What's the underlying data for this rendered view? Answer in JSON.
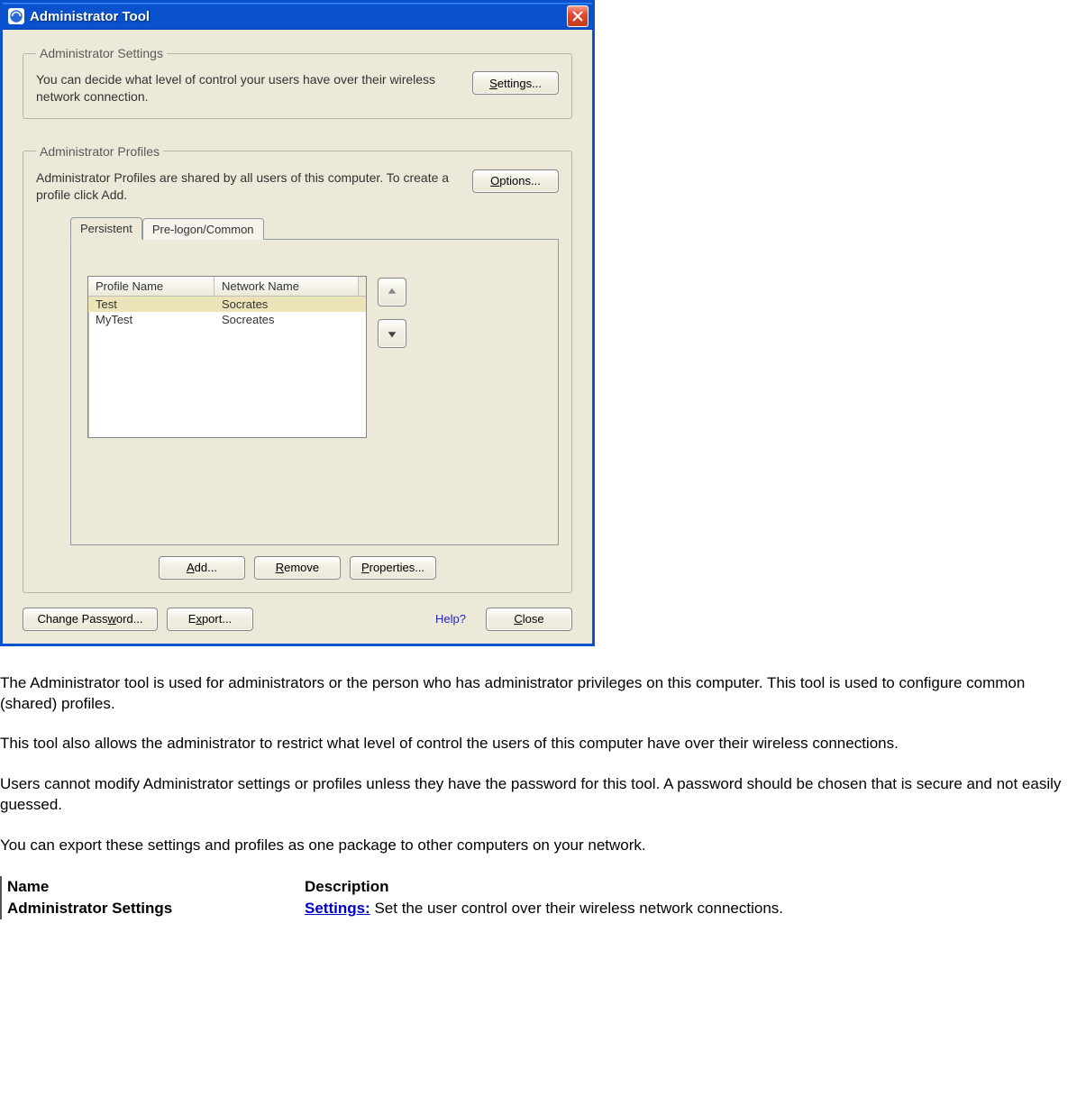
{
  "window": {
    "title": "Administrator Tool"
  },
  "admin_settings": {
    "legend": "Administrator Settings",
    "text": "You can decide what level of control your users have over their wireless network connection.",
    "button": "Settings..."
  },
  "admin_profiles": {
    "legend": "Administrator Profiles",
    "text": "Administrator Profiles are shared by all users of this computer. To create a profile click Add.",
    "button": "Options...",
    "tabs": {
      "persistent": "Persistent",
      "prelogon": "Pre-logon/Common"
    },
    "columns": {
      "profile_name": "Profile Name",
      "network_name": "Network Name"
    },
    "rows": [
      {
        "profile": "Test",
        "network": "Socrates"
      },
      {
        "profile": "MyTest",
        "network": "Socreates"
      }
    ],
    "actions": {
      "add": "Add...",
      "remove": "Remove",
      "properties": "Properties..."
    }
  },
  "bottom": {
    "change_password": "Change Password...",
    "export": "Export...",
    "help": "Help?",
    "close": "Close"
  },
  "doc": {
    "p1": "The Administrator tool is used for administrators or the person who has administrator privileges on this computer. This tool is used to configure common (shared) profiles.",
    "p2": "This tool also allows the administrator to restrict what level of control the users of this computer have over their wireless connections.",
    "p3": "Users cannot modify Administrator settings or profiles unless they have the password for this tool. A password should be chosen that is secure and not easily guessed.",
    "p4": "You can export these settings and profiles as one package to other computers on your network.",
    "table": {
      "name_header": "Name",
      "desc_header": "Description",
      "row1_name": "Administrator Settings",
      "row1_link": "Settings:",
      "row1_desc": " Set the user control over their wireless network connections."
    }
  }
}
